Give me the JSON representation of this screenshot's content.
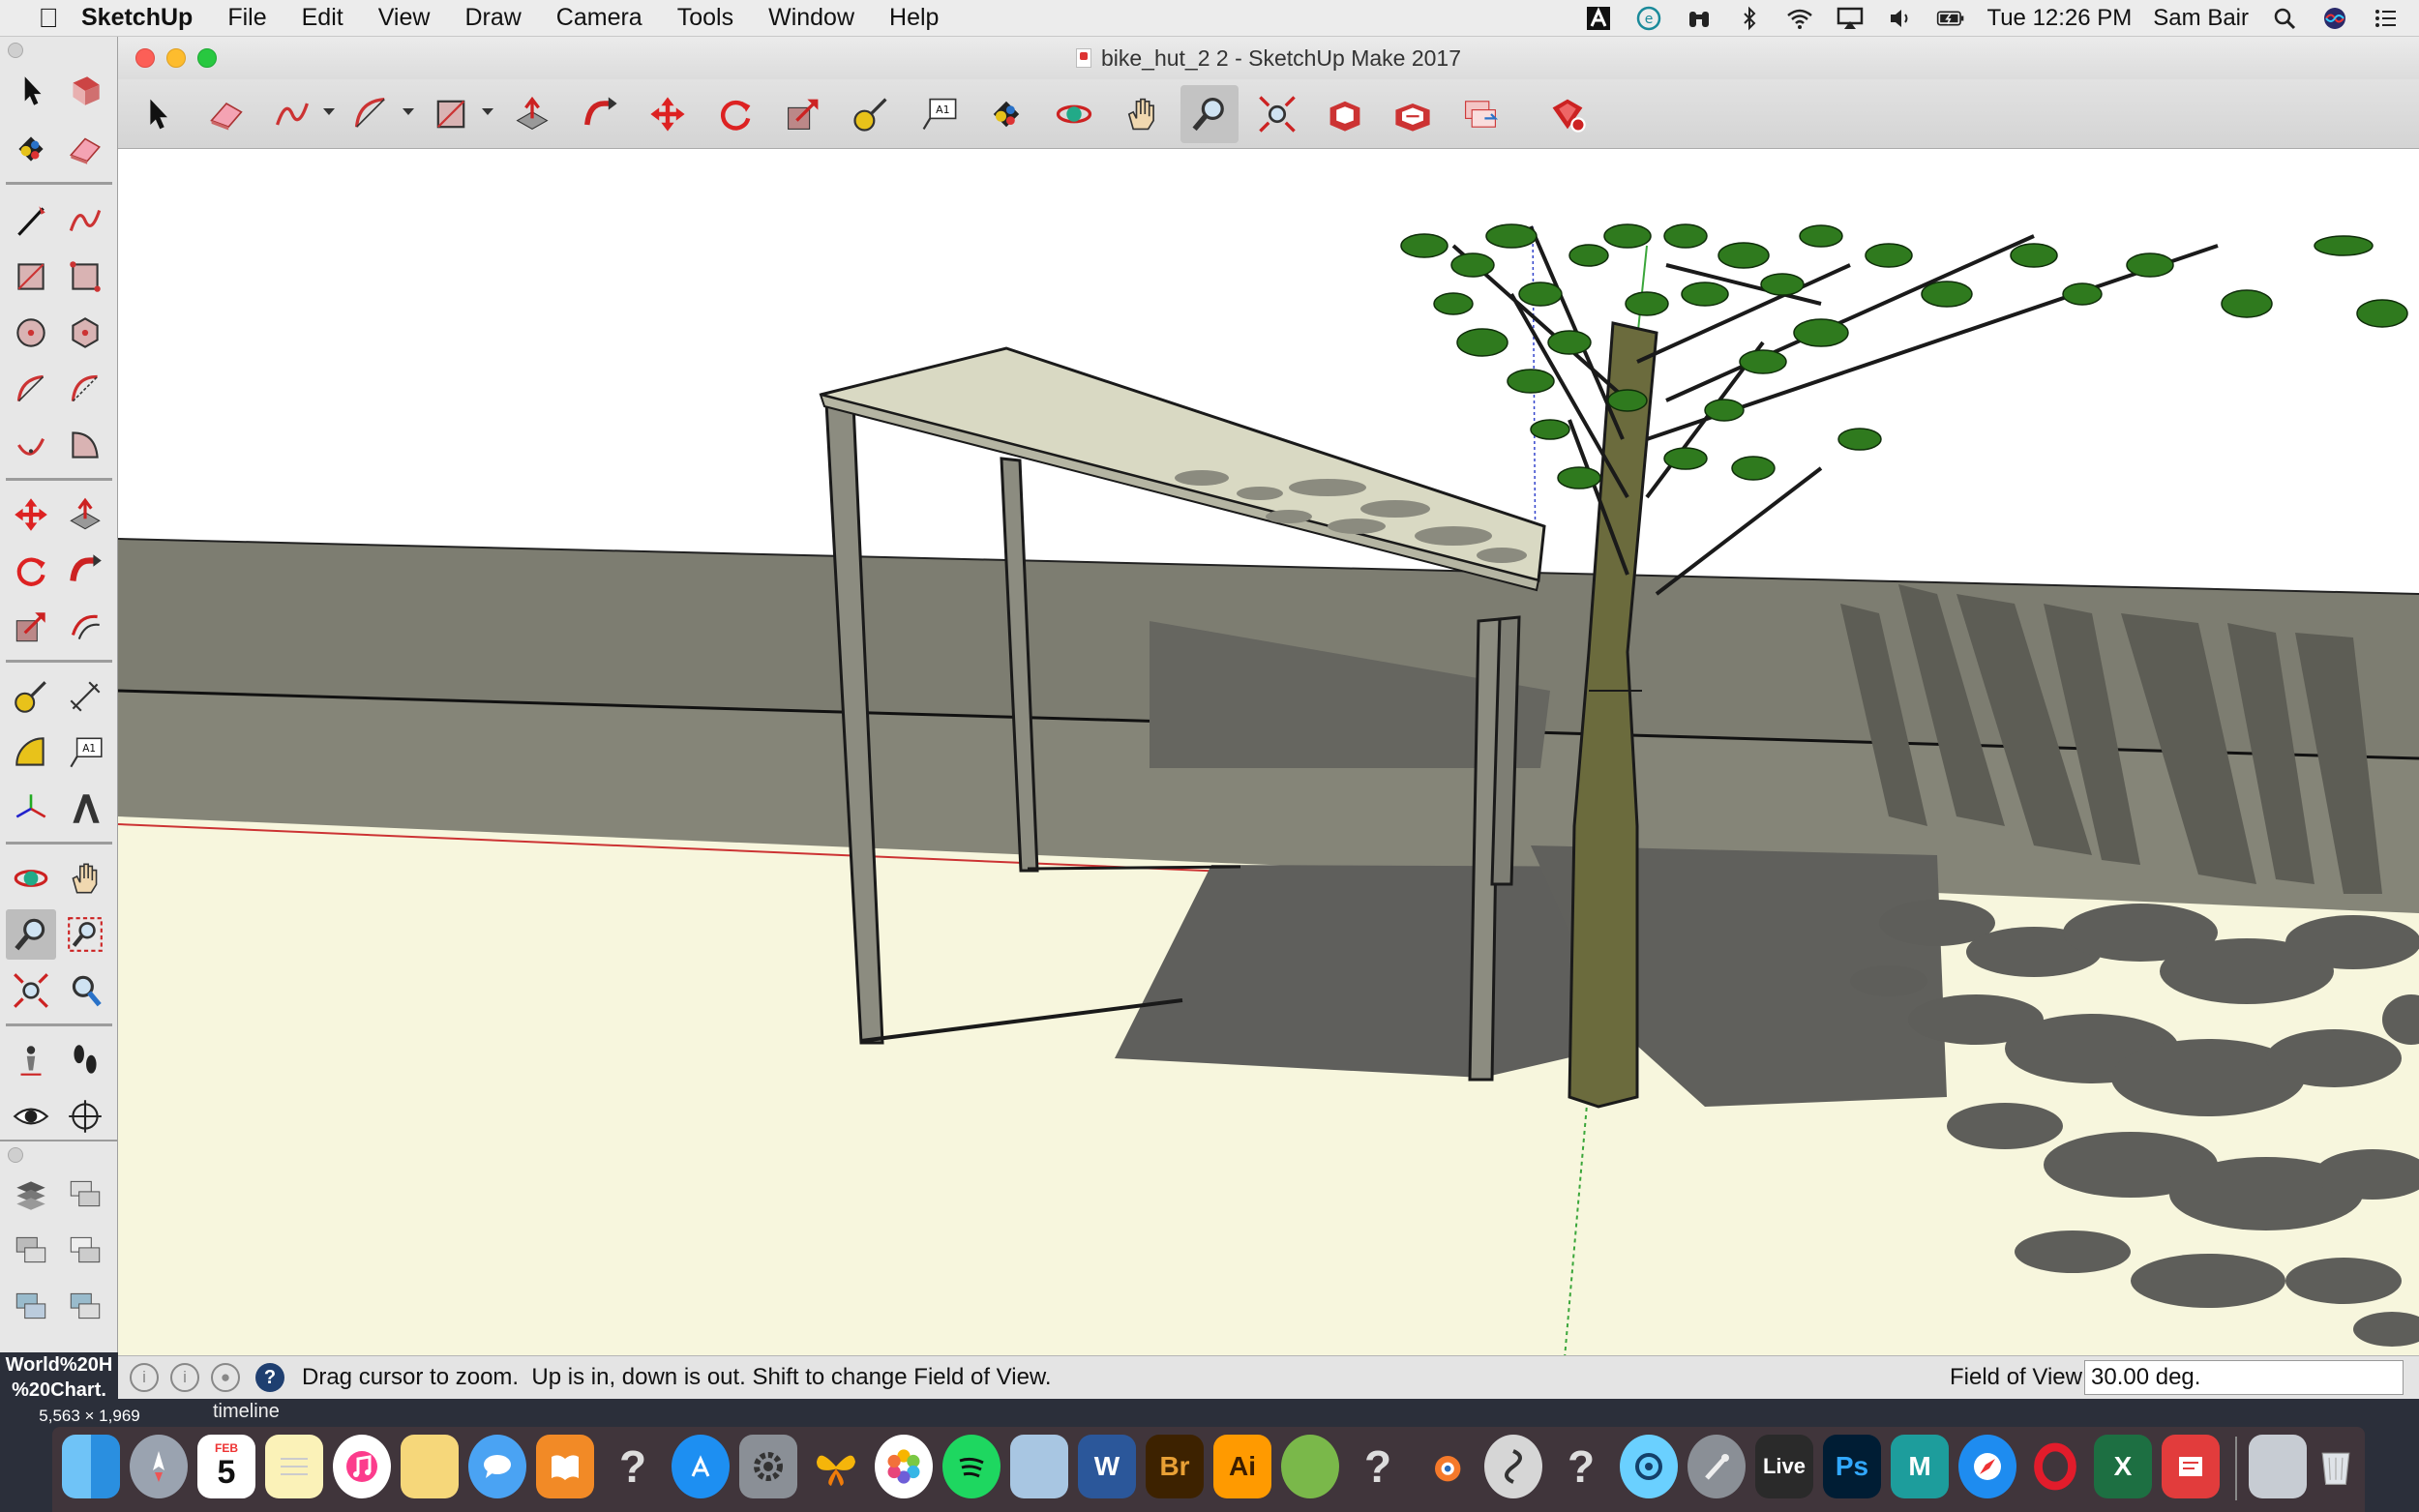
{
  "menubar": {
    "app_name": "SketchUp",
    "menus": [
      "File",
      "Edit",
      "View",
      "Draw",
      "Camera",
      "Tools",
      "Window",
      "Help"
    ],
    "clock": "Tue 12:26 PM",
    "user": "Sam Bair"
  },
  "window": {
    "title": "bike_hut_2 2 - SketchUp Make 2017"
  },
  "statusbar": {
    "message": "Drag cursor to zoom.  Up is in, down is out. Shift to change Field of View.",
    "fov_label": "Field of View",
    "fov_value": "30.00 deg."
  },
  "desktop": {
    "file_label_line1": "World%20H",
    "file_label_line2": "%20Chart.",
    "file_size": "5,563 × 1,969",
    "timeline_label": "timeline"
  },
  "dock": {
    "calendar_month": "FEB",
    "calendar_day": "5",
    "labels": {
      "word": "W",
      "bridge": "Br",
      "illustrator": "Ai",
      "live": "Live",
      "photoshop": "Ps",
      "maya": "M",
      "excel": "X"
    }
  },
  "colors": {
    "sky": "#ffffff",
    "ground": "#f7f6dd",
    "wall": "#7c7c70",
    "shadow": "#5e5e5a",
    "roof": "#d8d8c2",
    "leaf": "#2f7a1e",
    "trunk": "#6b6b3a"
  }
}
